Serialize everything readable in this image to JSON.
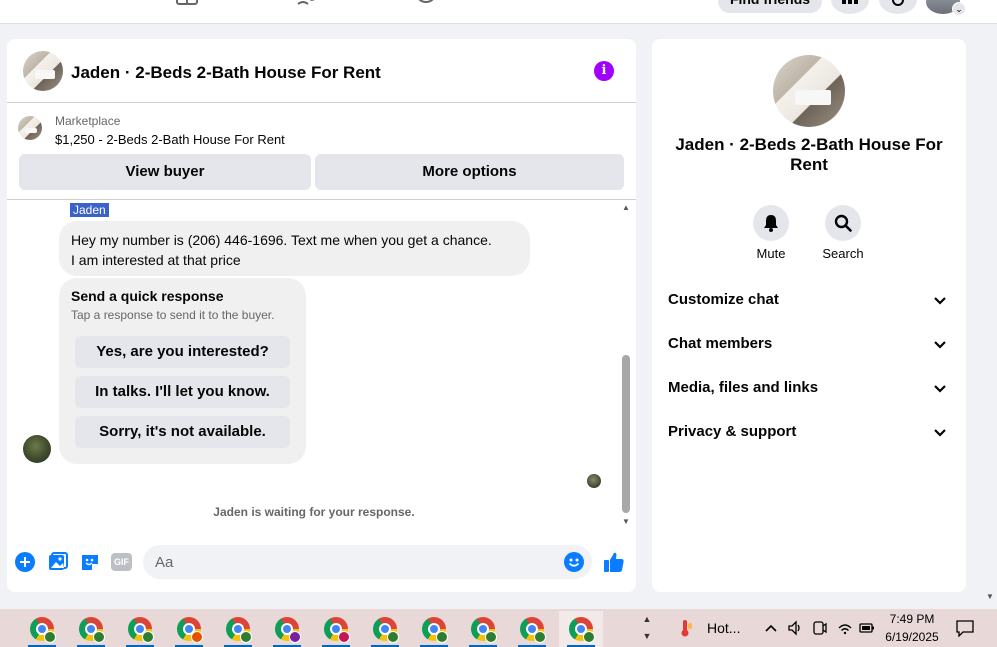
{
  "top_nav": {
    "find_friends_label": "Find friends"
  },
  "chat": {
    "title": "Jaden · 2-Beds 2-Bath House For Rent",
    "listing": {
      "kicker": "Marketplace",
      "price_title": "$1,250 - 2-Beds 2-Bath House For Rent"
    },
    "view_buyer_label": "View buyer",
    "more_options_label": "More options",
    "sender_name": "Jaden",
    "message_lines": [
      "Hey my number is (206) 446-1696. Text me when you get a chance.",
      "I am interested at that price"
    ],
    "quick_response": {
      "title": "Send a quick response",
      "subtitle": "Tap a response to send it to the buyer.",
      "options": [
        "Yes, are you interested?",
        "In talks. I'll let you know.",
        "Sorry, it's not available."
      ]
    },
    "waiting_text": "Jaden is waiting for your response.",
    "composer_placeholder": "Aa",
    "composer_value": "",
    "gif_label": "GIF"
  },
  "details": {
    "title": "Jaden · 2-Beds 2-Bath House For Rent",
    "mute_label": "Mute",
    "search_label": "Search",
    "rows": [
      "Customize chat",
      "Chat members",
      "Media, files and links",
      "Privacy & support"
    ]
  },
  "taskbar": {
    "app_count": 12,
    "active_app_index": 11,
    "profile_colors": [
      "#2e7d32",
      "#2e7d32",
      "#2e7d32",
      "#e65100",
      "#2e7d32",
      "#7b1fa2",
      "#c2185b",
      "#2e7d32",
      "#2e7d32",
      "#2e7d32",
      "#2e7d32",
      "#2e7d32"
    ],
    "weather_text": "Hot...",
    "time": "7:49 PM",
    "date": "6/19/2025"
  },
  "colors": {
    "messenger_blue": "#0a7cff",
    "info_purple": "#a100ff",
    "selection_blue": "#3a62c7"
  }
}
